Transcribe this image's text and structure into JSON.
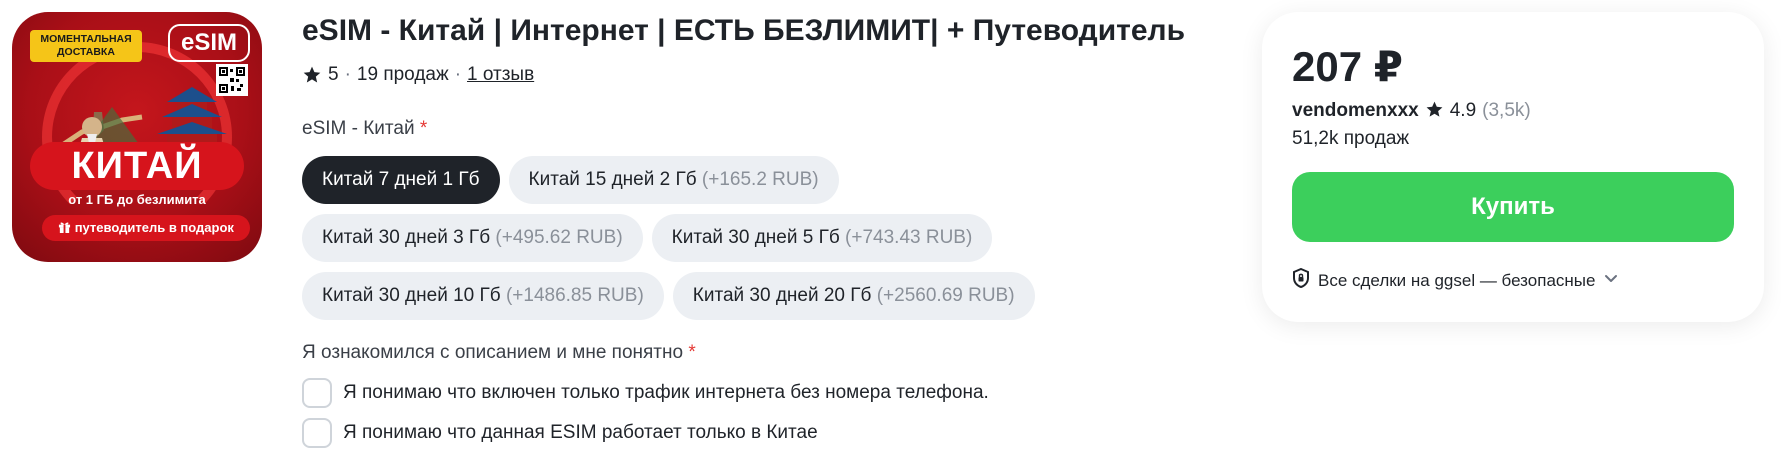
{
  "image": {
    "badge_delivery": "МОМЕНТАЛЬНАЯ ДОСТАВКА",
    "badge_esim": "eSIM",
    "banner": "КИТАЙ",
    "subtitle": "от 1 ГБ до безлимита",
    "gift": "путеводитель в подарок"
  },
  "product": {
    "title": "eSIM - Китай | Интернет | ЕСТЬ БЕЗЛИМИТ| + Путеводитель",
    "rating": "5",
    "sales": "19 продаж",
    "reviews": "1 отзыв"
  },
  "variant": {
    "label": "eSIM - Китай",
    "required": "*",
    "options": [
      {
        "name": "Китай 7 дней 1 Гб",
        "extra": ""
      },
      {
        "name": "Китай 15 дней 2 Гб",
        "extra": "(+165.2 RUB)"
      },
      {
        "name": "Китай 30 дней 3 Гб",
        "extra": "(+495.62 RUB)"
      },
      {
        "name": "Китай 30 дней 5 Гб",
        "extra": "(+743.43 RUB)"
      },
      {
        "name": "Китай 30 дней 10 Гб",
        "extra": "(+1486.85 RUB)"
      },
      {
        "name": "Китай 30 дней 20 Гб",
        "extra": "(+2560.69 RUB)"
      }
    ],
    "selected_index": 0
  },
  "agreement": {
    "label": "Я ознакомился с описанием и мне понятно",
    "required": "*",
    "items": [
      "Я понимаю что включен только трафик интернета без номера телефона.",
      "Я понимаю что данная ESIM работает только в Китае"
    ]
  },
  "card": {
    "price": "207 ₽",
    "seller_name": "vendomenxxx",
    "seller_rating": "4.9",
    "seller_reviews": "(3,5k)",
    "seller_sales": "51,2k продаж",
    "buy_label": "Купить",
    "safe_text": "Все сделки на ggsel — безопасные"
  },
  "colors": {
    "accent_green": "#3ccf5c",
    "selected_chip": "#1f2329",
    "chip": "#eceff3",
    "required": "#e53935"
  },
  "icons": {
    "rating": "star-icon",
    "safe": "shield-icon",
    "expand": "chevron-down-icon",
    "gift": "gift-icon"
  }
}
